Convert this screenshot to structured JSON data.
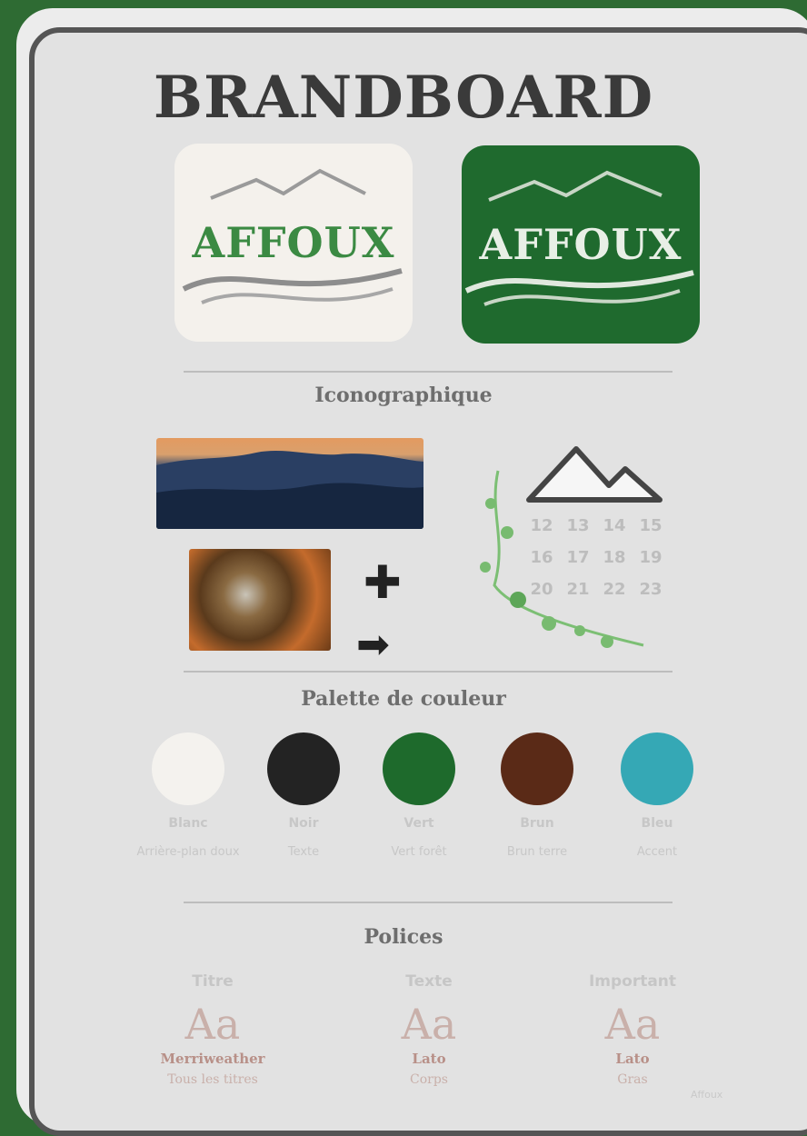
{
  "board": {
    "title": "BRANDBOARD",
    "logos": [
      {
        "text": "AFFOUX",
        "variant": "light",
        "background": "#f4f1ec",
        "text_color": "#3b8a43"
      },
      {
        "text": "AFFOUX",
        "variant": "dark",
        "background": "#1f6a2e",
        "text_color": "#e8efe6"
      }
    ],
    "sections": {
      "iconography": "Iconographique",
      "palette": "Palette de couleur",
      "fonts": "Polices"
    },
    "iconography": {
      "icons": [
        "plus-icon",
        "arrow-right-icon",
        "mountain-icon",
        "calendar-icon",
        "plant-icon"
      ],
      "calendar_days": [
        "12",
        "13",
        "14",
        "15",
        "16",
        "17",
        "18",
        "19",
        "20",
        "21",
        "22",
        "23"
      ]
    },
    "palette": [
      {
        "name": "Blanc",
        "desc": "Arrière-plan doux",
        "color": "#f4f2ee"
      },
      {
        "name": "Noir",
        "desc": "Texte",
        "color": "#232323"
      },
      {
        "name": "Vert",
        "desc": "Vert forêt",
        "color": "#1e6a2c"
      },
      {
        "name": "Brun",
        "desc": "Brun terre",
        "color": "#5a2a17"
      },
      {
        "name": "Bleu",
        "desc": "Accent",
        "color": "#35a8b5"
      }
    ],
    "fonts": [
      {
        "label": "Titre",
        "sample": "Aa",
        "name": "Merriweather",
        "sub": "Tous les titres"
      },
      {
        "label": "Texte",
        "sample": "Aa",
        "name": "Lato",
        "sub": "Corps"
      },
      {
        "label": "Important",
        "sample": "Aa",
        "name": "Lato",
        "sub": "Gras"
      }
    ],
    "watermark": "Affoux"
  }
}
